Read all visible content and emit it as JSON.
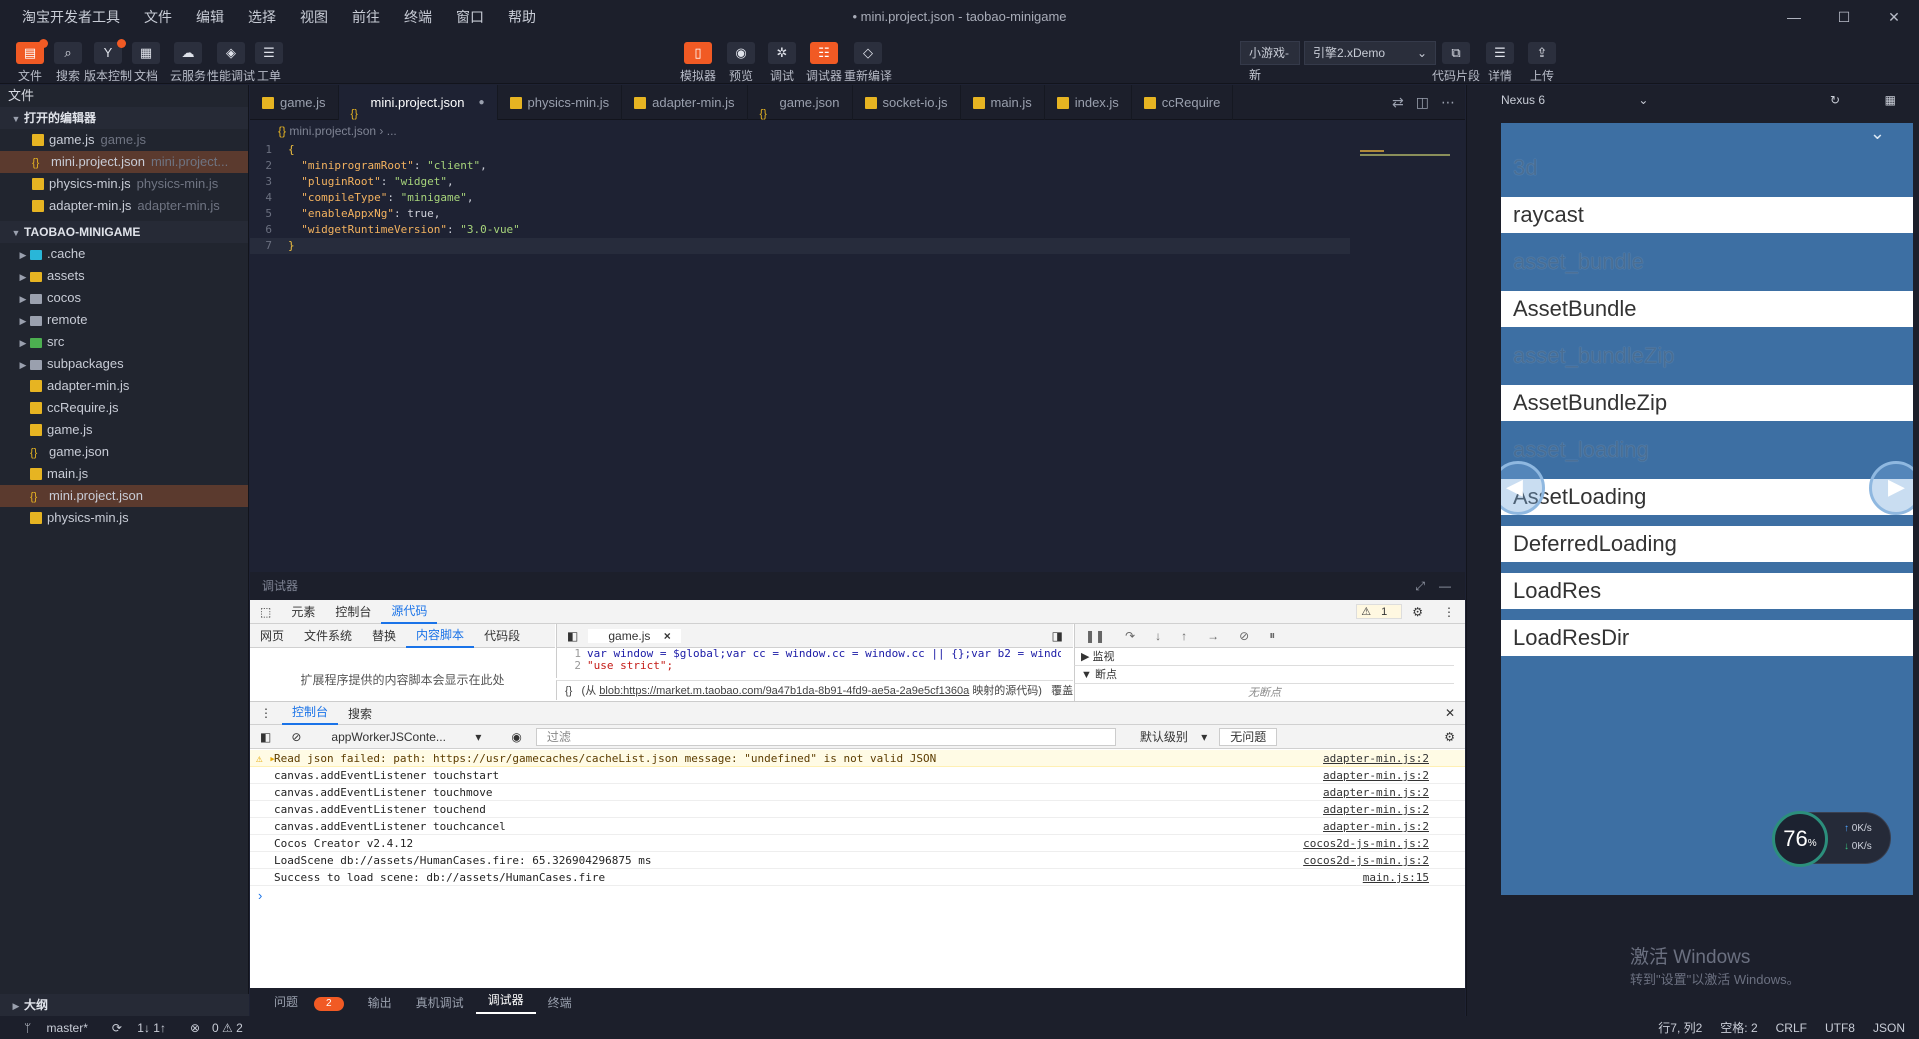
{
  "menu": [
    "淘宝开发者工具",
    "文件",
    "编辑",
    "选择",
    "视图",
    "前往",
    "终端",
    "窗口",
    "帮助"
  ],
  "window_title": "• mini.project.json - taobao-minigame",
  "window_controls": {
    "min": "—",
    "max": "☐",
    "close": "✕"
  },
  "toolbar": {
    "left": [
      {
        "label": "文件",
        "icon": "file-icon"
      },
      {
        "label": "搜索",
        "icon": "search-icon"
      },
      {
        "label": "版本控制",
        "icon": "branch-icon"
      },
      {
        "label": "文档",
        "icon": "doc-icon"
      },
      {
        "label": "云服务",
        "icon": "cloud-icon"
      },
      {
        "label": "性能调试",
        "icon": "perf-icon"
      },
      {
        "label": "工单",
        "icon": "ticket-icon"
      }
    ],
    "center": [
      {
        "label": "模拟器",
        "icon": "phone-icon"
      },
      {
        "label": "预览",
        "icon": "eye-icon"
      },
      {
        "label": "调试",
        "icon": "bug-icon"
      },
      {
        "label": "调试器",
        "icon": "sliders-icon"
      },
      {
        "label": "重新编译",
        "icon": "layers-icon"
      }
    ],
    "mode_select": "小游戏-新",
    "engine_select": "引擎2.xDemo",
    "right": [
      {
        "label": "代码片段",
        "icon": "copy-icon"
      },
      {
        "label": "详情",
        "icon": "list-icon"
      },
      {
        "label": "上传",
        "icon": "upload-icon"
      }
    ]
  },
  "sidebar": {
    "title": "文件",
    "open_editors_title": "打开的编辑器",
    "open_editors": [
      {
        "name": "game.js",
        "path": "game.js",
        "type": "js"
      },
      {
        "name": "mini.project.json",
        "path": "mini.project...",
        "type": "json"
      },
      {
        "name": "physics-min.js",
        "path": "physics-min.js",
        "type": "js"
      },
      {
        "name": "adapter-min.js",
        "path": "adapter-min.js",
        "type": "js"
      }
    ],
    "project_title": "TAOBAO-MINIGAME",
    "tree": [
      {
        "name": ".cache",
        "type": "dir-c"
      },
      {
        "name": "assets",
        "type": "dir-y"
      },
      {
        "name": "cocos",
        "type": "dir"
      },
      {
        "name": "remote",
        "type": "dir"
      },
      {
        "name": "src",
        "type": "dir-g"
      },
      {
        "name": "subpackages",
        "type": "dir"
      },
      {
        "name": "adapter-min.js",
        "type": "js"
      },
      {
        "name": "ccRequire.js",
        "type": "js"
      },
      {
        "name": "game.js",
        "type": "js"
      },
      {
        "name": "game.json",
        "type": "json"
      },
      {
        "name": "main.js",
        "type": "js"
      },
      {
        "name": "mini.project.json",
        "type": "json"
      },
      {
        "name": "physics-min.js",
        "type": "js"
      }
    ],
    "outline_title": "大纲"
  },
  "tabs": [
    {
      "name": "game.js",
      "type": "js"
    },
    {
      "name": "mini.project.json",
      "type": "json"
    },
    {
      "name": "physics-min.js",
      "type": "js"
    },
    {
      "name": "adapter-min.js",
      "type": "js"
    },
    {
      "name": "game.json",
      "type": "json"
    },
    {
      "name": "socket-io.js",
      "type": "js"
    },
    {
      "name": "main.js",
      "type": "js"
    },
    {
      "name": "index.js",
      "type": "js"
    },
    {
      "name": "ccRequire",
      "type": "js"
    }
  ],
  "breadcrumb": [
    "mini.project.json",
    "..."
  ],
  "code_lines": [
    [
      "1",
      "{"
    ],
    [
      "2",
      "  \"miniprogramRoot\": \"client\","
    ],
    [
      "3",
      "  \"pluginRoot\": \"widget\","
    ],
    [
      "4",
      "  \"compileType\": \"minigame\","
    ],
    [
      "5",
      "  \"enableAppxNg\": true,"
    ],
    [
      "6",
      "  \"widgetRuntimeVersion\": \"3.0-vue\""
    ],
    [
      "7",
      "}"
    ]
  ],
  "debugger_title": "调试器",
  "devtools": {
    "main_tabs": [
      "元素",
      "控制台",
      "源代码"
    ],
    "warn_count": "1",
    "nav_tabs": [
      "网页",
      "文件系统",
      "替换",
      "内容脚本",
      "代码段"
    ],
    "content_scripts_empty": "扩展程序提供的内容脚本会显示在此处",
    "open_file": "game.js",
    "source_lines": [
      [
        "1",
        "var window = $global;var cc = window.cc = window.cc || {};var b2 = window.b2 = window.b"
      ],
      [
        "2",
        "\"use strict\";"
      ]
    ],
    "source_footer_prefix": "(从",
    "source_footer_link": "blob:https://market.m.taobao.com/9a47b1da-8b91-4fd9-ae5a-2a9e5cf1360a",
    "source_footer_suffix": "映射的源代码)",
    "coverage": "覆盖率: 不适",
    "watch": "监视",
    "breakpoints": "断点",
    "no_breakpoints": "无断点",
    "drawer_tabs": [
      "控制台",
      "搜索"
    ],
    "context": "appWorkerJSConte...",
    "filter_placeholder": "过滤",
    "level": "默认级别",
    "no_issues": "无问题",
    "logs": [
      {
        "msg": "Read json failed: path: https://usr/gamecaches/cacheList.json message: \"undefined\" is not valid JSON",
        "src": "adapter-min.js:2",
        "warn": true
      },
      {
        "msg": "canvas.addEventListener touchstart",
        "src": "adapter-min.js:2"
      },
      {
        "msg": "canvas.addEventListener touchmove",
        "src": "adapter-min.js:2"
      },
      {
        "msg": "canvas.addEventListener touchend",
        "src": "adapter-min.js:2"
      },
      {
        "msg": "canvas.addEventListener touchcancel",
        "src": "adapter-min.js:2"
      },
      {
        "msg": "Cocos Creator v2.4.12",
        "src": "cocos2d-js-min.js:2"
      },
      {
        "msg": "LoadScene db://assets/HumanCases.fire: 65.326904296875 ms",
        "src": "cocos2d-js-min.js:2"
      },
      {
        "msg": "Success to load scene: db://assets/HumanCases.fire",
        "src": "main.js:15"
      }
    ]
  },
  "bottom_tabs": [
    {
      "label": "问题",
      "badge": "2"
    },
    {
      "label": "输出"
    },
    {
      "label": "真机调试"
    },
    {
      "label": "调试器"
    },
    {
      "label": "终端"
    }
  ],
  "status": {
    "branch": "master*",
    "sync": "1↓ 1↑",
    "problems": "0 ⚠ 2",
    "cursor": "行7, 列2",
    "spaces": "空格: 2",
    "eol": "CRLF",
    "encoding": "UTF8",
    "lang": "JSON"
  },
  "simulator": {
    "device": "Nexus 6",
    "items": [
      {
        "text": "3d",
        "style": "b"
      },
      {
        "text": "raycast",
        "style": "w"
      },
      {
        "text": "asset_bundle",
        "style": "b"
      },
      {
        "text": "AssetBundle",
        "style": "w"
      },
      {
        "text": "asset_bundleZip",
        "style": "b"
      },
      {
        "text": "AssetBundleZip",
        "style": "w"
      },
      {
        "text": "asset_loading",
        "style": "b"
      },
      {
        "text": "AssetLoading",
        "style": "w"
      },
      {
        "text": "DeferredLoading",
        "style": "w"
      },
      {
        "text": "LoadRes",
        "style": "w"
      },
      {
        "text": "LoadResDir",
        "style": "w"
      }
    ],
    "fps": "76",
    "fps_unit": "%",
    "up_speed": "0K/s",
    "down_speed": "0K/s"
  },
  "watermark": {
    "line1": "激活 Windows",
    "line2": "转到\"设置\"以激活 Windows。"
  },
  "colors": {
    "accent": "#f15a24",
    "editor_bg": "#1e2233",
    "phone_bg": "#3d6fa3"
  }
}
